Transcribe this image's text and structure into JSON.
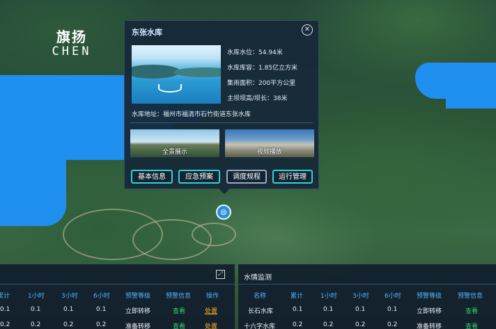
{
  "logo": {
    "cn": "旗扬",
    "en": "CHEN"
  },
  "popup": {
    "title": "东张水库",
    "info": {
      "water_level": "水库水位：54.94米",
      "capacity": "水库库容：1.85亿立方米",
      "catchment": "集雨面积：200平方公里",
      "dam": "主坝坝高/坝长：38米",
      "address": "水库地址：福州市福清市石竹街道东张水库"
    },
    "thumbs": [
      "全景展示",
      "视频播放"
    ],
    "buttons": [
      "基本信息",
      "应急预案",
      "调度规程",
      "运行管理"
    ]
  },
  "marker_icon": "reservoir-icon",
  "left_panel": {
    "headers": [
      "累计",
      "1小时",
      "3小时",
      "6小时",
      "预警等级",
      "预警信息",
      "操作"
    ],
    "rows": [
      [
        "0.1",
        "0.1",
        "0.1",
        "0.1",
        "立即转移",
        "查看",
        "处置"
      ],
      [
        "0.2",
        "0.2",
        "0.2",
        "0.2",
        "准备转移",
        "查看",
        "处置"
      ]
    ]
  },
  "right_panel": {
    "title": "水情监测",
    "headers": [
      "名称",
      "累计",
      "1小时",
      "3小时",
      "6小时",
      "预警等级",
      "预警信息"
    ],
    "rows": [
      [
        "长石水库",
        "0.1",
        "0.1",
        "0.1",
        "0.1",
        "立即转移",
        "查看"
      ],
      [
        "十六字水库",
        "0.2",
        "0.2",
        "0.2",
        "0.2",
        "准备转移",
        "查看"
      ]
    ]
  },
  "colors": {
    "accent": "#2fd3d8",
    "header_text": "#4fb6ff",
    "link_green": "#2fd16a",
    "link_orange": "#ffb020",
    "water": "#1f8ff0"
  }
}
